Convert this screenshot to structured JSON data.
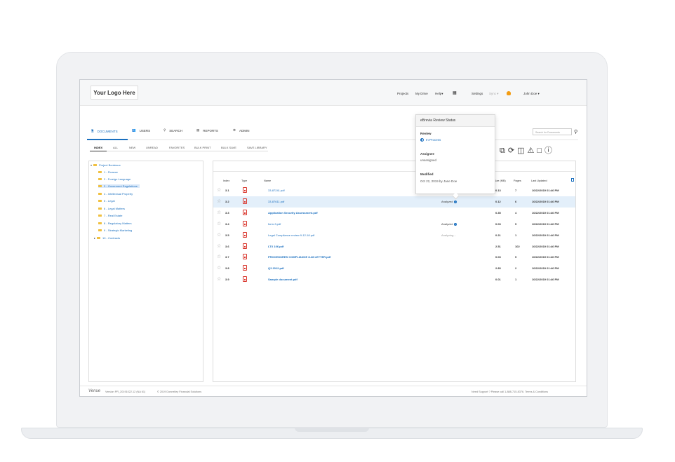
{
  "topbar": {
    "logo": "Your Logo Here",
    "nav": [
      "Projects",
      "My Drive",
      "Help",
      "Settings",
      "Sync"
    ],
    "user": "John Doe"
  },
  "tabs": [
    {
      "label": "DOCUMENTS",
      "icon": "documents-icon"
    },
    {
      "label": "USERS",
      "icon": "users-icon"
    },
    {
      "label": "SEARCH",
      "icon": "search-icon"
    },
    {
      "label": "REPORTS",
      "icon": "reports-icon"
    },
    {
      "label": "ADMIN",
      "icon": "gear-icon"
    }
  ],
  "subtabs": [
    "INDEX",
    "ALL",
    "NEW",
    "UNREAD",
    "FAVORITES",
    "BULK PRINT",
    "BULK SAVE",
    "SAVE LIBRARY"
  ],
  "search": {
    "placeholder": "Search for Documents"
  },
  "tree": {
    "root": "Project Bordeaux",
    "items": [
      "1 - Finance",
      "2 - Foreign Language",
      "3 - Goverment Regulations",
      "4 - Intellectual Property",
      "5 - Legal",
      "6 - Legal Matters",
      "7 - Real Estate",
      "8 - Regulatory Matters",
      "9 - Strategic Marketing",
      "10 - Contracts"
    ],
    "selected_index": 2
  },
  "table": {
    "columns": [
      "Index",
      "Type",
      "Name",
      "Size (MB)",
      "Pages",
      "Last Updated"
    ],
    "rows": [
      {
        "index": "3.1",
        "name": "33-87241.pdf",
        "status": "",
        "size": "0.13",
        "pages": "7",
        "updated": "10/22/2019 01:46 PM"
      },
      {
        "index": "3.2",
        "name": "33-87611.pdf",
        "status": "Analyzed",
        "size": "0.12",
        "pages": "6",
        "updated": "10/22/2019 01:46 PM"
      },
      {
        "index": "3.3",
        "name": "Application Security Assessment.pdf",
        "status": "",
        "size": "0.35",
        "pages": "4",
        "updated": "10/22/2019 01:46 PM"
      },
      {
        "index": "3.4",
        "name": "form-3.pdf",
        "status": "Analyzed",
        "size": "0.03",
        "pages": "5",
        "updated": "10/22/2019 01:46 PM"
      },
      {
        "index": "3.5",
        "name": "Legal Compliance review 9-12-18.pdf",
        "status": "Analyzing...",
        "size": "0.21",
        "pages": "1",
        "updated": "10/22/2019 01:46 PM"
      },
      {
        "index": "3.6",
        "name": "LTX 106.pdf",
        "status": "",
        "size": "2.51",
        "pages": "102",
        "updated": "10/22/2019 01:46 PM"
      },
      {
        "index": "3.7",
        "name": "PROCEDURES COMPLIANCE 8-28 LETTER.pdf",
        "status": "",
        "size": "0.03",
        "pages": "5",
        "updated": "10/22/2019 01:46 PM"
      },
      {
        "index": "3.8",
        "name": "Q3 2012.pdf",
        "status": "",
        "size": "2.83",
        "pages": "2",
        "updated": "10/22/2019 01:46 PM"
      },
      {
        "index": "3.9",
        "name": "Sample document.pdf",
        "status": "",
        "size": "0.01",
        "pages": "1",
        "updated": "10/22/2019 01:46 PM"
      }
    ]
  },
  "popover": {
    "title": "eBrevia Review Status",
    "review_label": "Review",
    "review_value": "In Process",
    "assignee_label": "Assignee",
    "assignee_value": "unassigned",
    "modified_label": "Modified",
    "modified_value": "Oct 22, 2019 by Jane Doe"
  },
  "footer": {
    "brand": "Venue",
    "version": "Version PR_20191022.12 (NA 61)",
    "copyright": "© 2019 Donnelley Financial Solutions",
    "support": "Need Support ? Please call 1-888-715-8376. Terms & Conditions"
  },
  "colors": {
    "accent": "#1a6fbf",
    "folder": "#f0c040",
    "pdf": "#d9342b",
    "highlight": "#e3effa"
  }
}
